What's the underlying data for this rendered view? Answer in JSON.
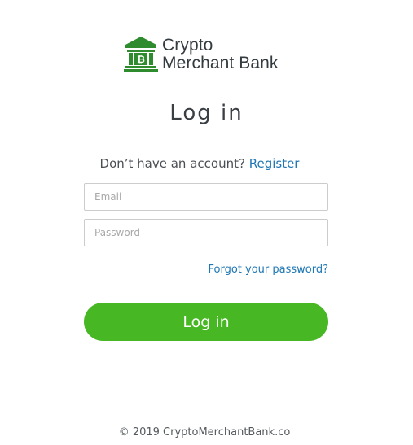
{
  "brand": {
    "line1": "Crypto",
    "line2": "Merchant Bank",
    "logo_icon": "bank-bitcoin-icon",
    "icon_color": "#2e8b2e",
    "text_color": "#333b3f"
  },
  "page": {
    "title": "Log in"
  },
  "register": {
    "prompt": "Don’t have an account?",
    "link": "Register",
    "link_color": "#1f77b4"
  },
  "form": {
    "email_placeholder": "Email",
    "email_value": "",
    "password_placeholder": "Password",
    "password_value": "",
    "forgot_link": "Forgot your password?",
    "submit_label": "Log in",
    "submit_color": "#47b823"
  },
  "footer": {
    "copyright": "© 2019 CryptoMerchantBank.co"
  }
}
